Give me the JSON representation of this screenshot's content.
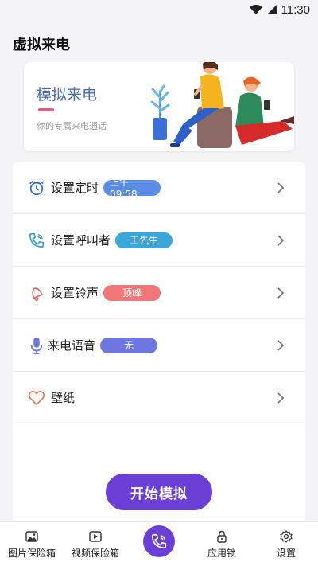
{
  "status_bar": {
    "time": "11:30"
  },
  "header": {
    "title": "虚拟来电"
  },
  "banner": {
    "title": "模拟来电",
    "subtitle": "你的专属来电通话"
  },
  "settings": [
    {
      "label": "设置定时",
      "value": "上午09:58",
      "badge_color": "#5b8de6",
      "icon": "alarm-clock-icon"
    },
    {
      "label": "设置呼叫者",
      "value": "王先生",
      "badge_color": "#3aa7d8",
      "icon": "phone-call-icon"
    },
    {
      "label": "设置铃声",
      "value": "顶峰",
      "badge_color": "#ef7777",
      "icon": "bell-icon"
    },
    {
      "label": "来电语音",
      "value": "无",
      "badge_color": "#6e76df",
      "icon": "microphone-icon"
    },
    {
      "label": "壁纸",
      "value": "",
      "badge_color": "",
      "icon": "heart-icon"
    }
  ],
  "actions": {
    "start_label": "开始模拟"
  },
  "tabbar": {
    "items": [
      {
        "label": "图片保险箱",
        "icon": "image-icon"
      },
      {
        "label": "视频保险箱",
        "icon": "video-icon"
      },
      {
        "label": "",
        "icon": "phone-icon"
      },
      {
        "label": "应用锁",
        "icon": "lock-icon"
      },
      {
        "label": "设置",
        "icon": "gear-icon"
      }
    ]
  },
  "colors": {
    "accent": "#6b3ed6",
    "banner_title": "#4b6da8",
    "banner_bar": "#e0607e"
  }
}
